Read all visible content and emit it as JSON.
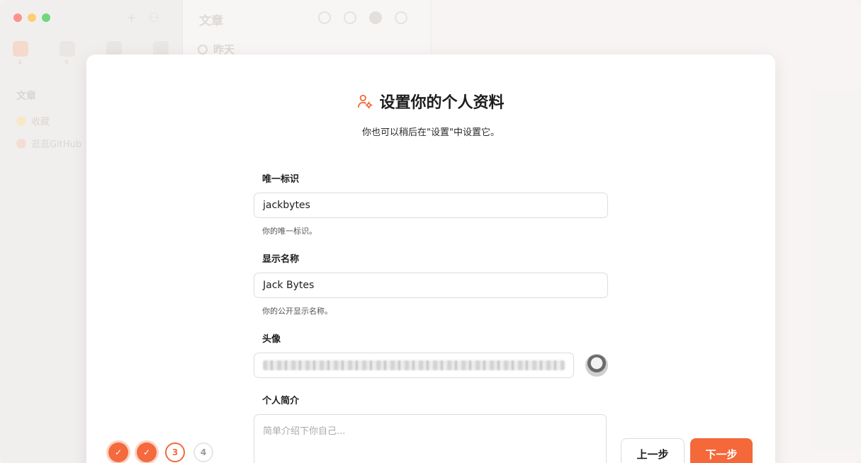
{
  "background": {
    "sidebar": {
      "section": "文章",
      "tab_counts": [
        "4",
        "9"
      ],
      "items": [
        {
          "label": "收藏"
        },
        {
          "label": "逛逛GitHub"
        }
      ]
    },
    "list_pane": {
      "title": "文章",
      "group": "昨天"
    }
  },
  "modal": {
    "title": "设置你的个人资料",
    "subtitle": "你也可以稍后在\"设置\"中设置它。",
    "fields": {
      "handle": {
        "label": "唯一标识",
        "value": "jackbytes",
        "help": "你的唯一标识。"
      },
      "display_name": {
        "label": "显示名称",
        "value": "Jack Bytes",
        "help": "你的公开显示名称。"
      },
      "avatar": {
        "label": "头像"
      },
      "bio": {
        "label": "个人简介",
        "placeholder": "简单介绍下你自己..."
      }
    },
    "steps": [
      {
        "state": "done",
        "label": "✓"
      },
      {
        "state": "done",
        "label": "✓"
      },
      {
        "state": "current",
        "label": "3"
      },
      {
        "state": "todo",
        "label": "4"
      }
    ],
    "buttons": {
      "prev": "上一步",
      "next": "下一步"
    }
  },
  "colors": {
    "accent": "#f4683a"
  }
}
